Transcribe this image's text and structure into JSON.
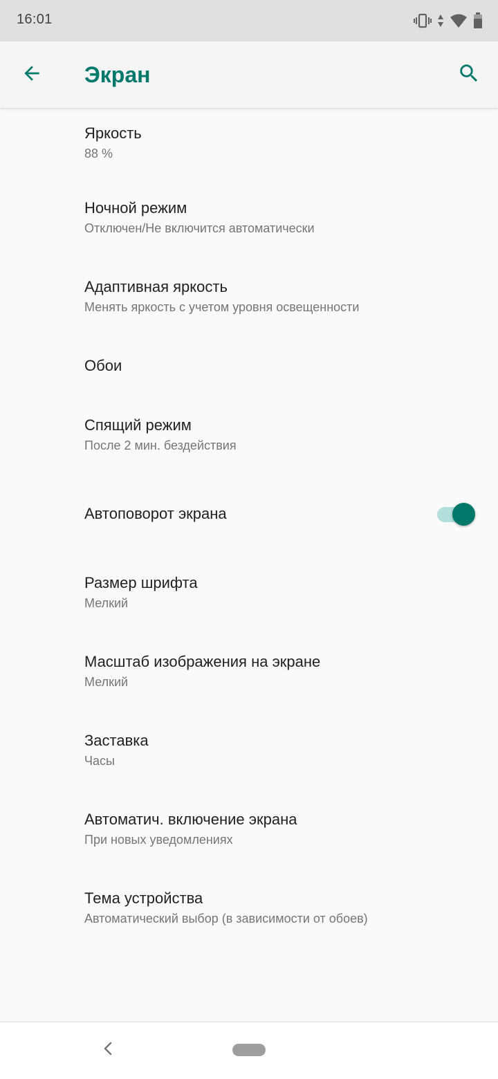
{
  "status_bar": {
    "time": "16:01",
    "icons": [
      "vibrate-icon",
      "data-arrows-icon",
      "wifi-icon",
      "battery-icon"
    ]
  },
  "app_bar": {
    "title": "Экран",
    "back_icon": "arrow-back-icon",
    "search_icon": "search-icon"
  },
  "settings": [
    {
      "title": "Яркость",
      "summary": "88 %"
    },
    {
      "title": "Ночной режим",
      "summary": "Отключен/Не включится автоматически"
    },
    {
      "title": "Адаптивная яркость",
      "summary": "Менять яркость с учетом уровня освещенности"
    },
    {
      "title": "Обои",
      "summary": ""
    },
    {
      "title": "Спящий режим",
      "summary": "После 2 мин. бездействия"
    },
    {
      "title": "Автоповорот экрана",
      "summary": "",
      "toggle_on": true
    },
    {
      "title": "Размер шрифта",
      "summary": "Мелкий"
    },
    {
      "title": "Масштаб изображения на экране",
      "summary": "Мелкий"
    },
    {
      "title": "Заставка",
      "summary": "Часы"
    },
    {
      "title": "Автоматич. включение экрана",
      "summary": "При новых уведомлениях"
    },
    {
      "title": "Тема устройства",
      "summary": "Автоматический выбор (в зависимости от обоев)"
    }
  ],
  "nav_bar": {
    "back_icon": "nav-back-icon",
    "home_icon": "nav-home-pill"
  },
  "colors": {
    "accent": "#00796b",
    "accent_light": "#b2dfdb",
    "status_bar_bg": "#e0e0e0",
    "app_bar_bg": "#f5f5f5",
    "background": "#fafafa"
  }
}
